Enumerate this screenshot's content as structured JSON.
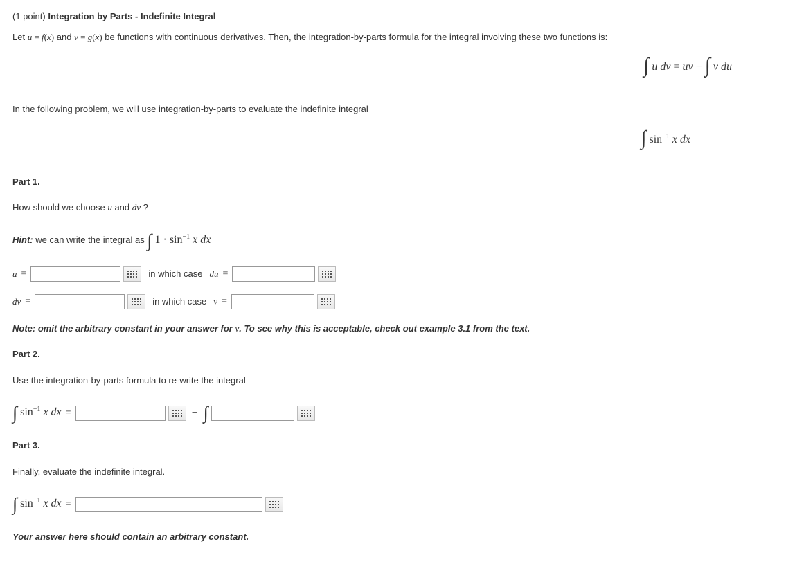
{
  "header": {
    "points": "(1 point)",
    "title": "Integration by Parts - Indefinite Integral"
  },
  "intro": {
    "p1_a": "Let ",
    "p1_b": " and ",
    "p1_c": " be functions with continuous derivatives. Then, the integration-by-parts formula for the integral involving these two functions is:",
    "u_eq": "u = f(x)",
    "v_eq": "v = g(x)",
    "formula_decor": " ",
    "p2": "In the following problem, we will use integration-by-parts to evaluate the indefinite integral"
  },
  "part1": {
    "title": "Part 1.",
    "q": "How should we choose ",
    "q_u": "u",
    "q_and": " and ",
    "q_dv": "dv",
    "q_end": "?",
    "hint_label": "Hint:",
    "hint_text": " we can write the integral as ",
    "u_label": "u",
    "du_text": " in which case ",
    "du_label": "du",
    "dv_label": "dv",
    "v_text": " in which case ",
    "v_label": "v",
    "note_a": "Note: omit the arbitrary constant in your answer for ",
    "note_v": "v",
    "note_b": ". To see why this is acceptable, check out example 3.1 from the text."
  },
  "part2": {
    "title": "Part 2.",
    "q": "Use the integration-by-parts formula to re-write the integral"
  },
  "part3": {
    "title": "Part 3.",
    "q": "Finally, evaluate the indefinite integral.",
    "note": "Your answer here should contain an arbitrary constant."
  },
  "math": {
    "sin_inv": "sin",
    "neg1": "−1",
    "x": " x",
    "dx": " dx",
    "one_dot": "1 · ",
    "udv": "u dv",
    "eq": " = ",
    "uv": "uv",
    "minus": " − ",
    "vdu": "v du"
  }
}
